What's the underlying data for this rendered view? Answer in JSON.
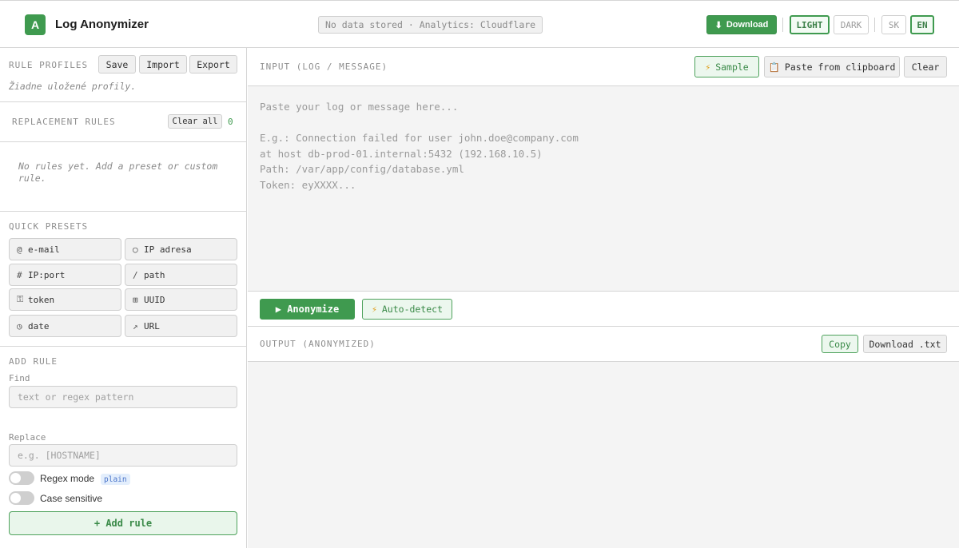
{
  "header": {
    "logo_letter": "A",
    "title": "Log Anonymizer",
    "privacy_note": "No data stored · Analytics: Cloudflare",
    "download_icon": "download-arrow-icon",
    "download_label": "Download",
    "theme_light": "LIGHT",
    "theme_dark": "DARK",
    "lang_sk": "SK",
    "lang_en": "EN",
    "accent_color": "#3f9a4f"
  },
  "sidebar": {
    "profiles": {
      "label": "RULE PROFILES",
      "save": "Save",
      "import": "Import",
      "export": "Export",
      "empty_note": "Žiadne uložené profily."
    },
    "rules": {
      "label": "REPLACEMENT RULES",
      "clear_all": "Clear all",
      "count": "0",
      "empty_note": "No rules yet. Add a preset or custom rule."
    },
    "presets": {
      "label": "QUICK PRESETS",
      "items": [
        {
          "icon": "@",
          "label": "e-mail"
        },
        {
          "icon": "○",
          "label": "IP adresa"
        },
        {
          "icon": "#",
          "label": "IP:port"
        },
        {
          "icon": "/",
          "label": "path"
        },
        {
          "icon": "⚿",
          "label": "token"
        },
        {
          "icon": "⊞",
          "label": "UUID"
        },
        {
          "icon": "◷",
          "label": "date"
        },
        {
          "icon": "↗",
          "label": "URL"
        }
      ]
    },
    "add_rule": {
      "label": "ADD RULE",
      "find_label": "Find",
      "find_placeholder": "text or regex pattern",
      "replace_label": "Replace",
      "replace_placeholder": "e.g. [HOSTNAME]",
      "regex_label": "Regex mode",
      "regex_badge": "plain",
      "case_label": "Case sensitive",
      "button": "+ Add rule"
    }
  },
  "main": {
    "input_label": "INPUT (LOG / MESSAGE)",
    "sample_icon": "lightning-icon",
    "sample": "Sample",
    "paste_icon": "clipboard-icon",
    "paste": "Paste from clipboard",
    "clear": "Clear",
    "input_placeholder": "Paste your log or message here...\n\nE.g.: Connection failed for user john.doe@company.com\nat host db-prod-01.internal:5432 (192.168.10.5)\nPath: /var/app/config/database.yml\nToken: eyXXXX...",
    "anonymize": "▶ Anonymize",
    "autodetect_icon": "lightning-icon",
    "autodetect": "Auto-detect",
    "output_label": "OUTPUT (ANONYMIZED)",
    "copy": "Copy",
    "download_txt": "Download .txt"
  }
}
